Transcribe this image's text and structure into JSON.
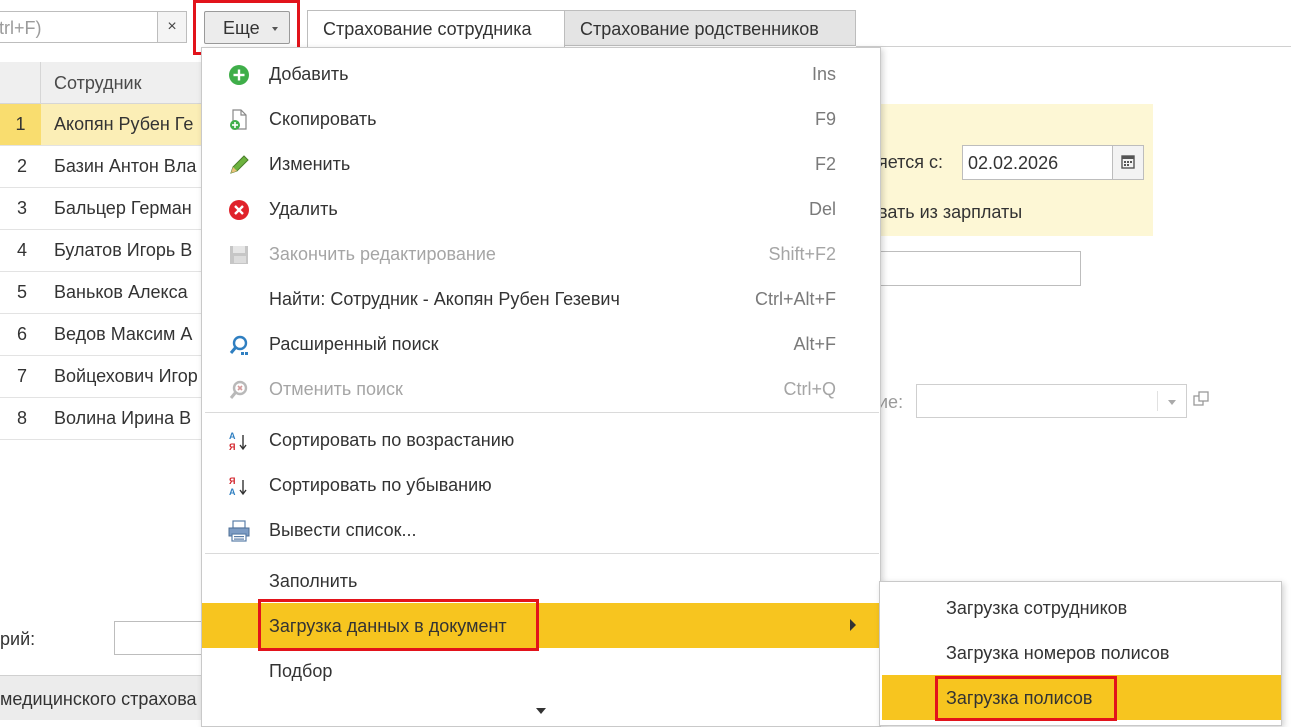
{
  "toolbar": {
    "search_placeholder": "(Ctrl+F)",
    "search_visible": "trl+F)",
    "clear_label": "×",
    "more_label": "Еще"
  },
  "tabs": [
    {
      "label": "Страхование сотрудника",
      "active": true
    },
    {
      "label": "Страхование родственников",
      "active": false
    }
  ],
  "table": {
    "header": "Сотрудник",
    "rows": [
      {
        "n": "1",
        "name": "Акопян Рубен Ге"
      },
      {
        "n": "2",
        "name": "Базин Антон Вла"
      },
      {
        "n": "3",
        "name": "Бальцер Герман"
      },
      {
        "n": "4",
        "name": "Булатов Игорь В"
      },
      {
        "n": "5",
        "name": "Ваньков Алекса"
      },
      {
        "n": "6",
        "name": "Ведов Максим А"
      },
      {
        "n": "7",
        "name": "Войцехович Игор"
      },
      {
        "n": "8",
        "name": "Волина Ирина В"
      }
    ]
  },
  "form": {
    "date_label": "яется с:",
    "date_value": "02.02.2026",
    "salary_text": "вать из зарплаты",
    "insurer_label": "ие:",
    "comment_label": "рий:",
    "bottom_text": "медицинского страхова"
  },
  "menu": {
    "items": [
      {
        "label": "Добавить",
        "shortcut": "Ins",
        "icon": "add-icon"
      },
      {
        "label": "Скопировать",
        "shortcut": "F9",
        "icon": "copy-icon"
      },
      {
        "label": "Изменить",
        "shortcut": "F2",
        "icon": "pencil-icon"
      },
      {
        "label": "Удалить",
        "shortcut": "Del",
        "icon": "delete-icon"
      },
      {
        "label": "Закончить редактирование",
        "shortcut": "Shift+F2",
        "icon": "save-icon",
        "disabled": true
      },
      {
        "label": "Найти: Сотрудник - Акопян Рубен Гезевич",
        "shortcut": "Ctrl+Alt+F"
      },
      {
        "label": "Расширенный поиск",
        "shortcut": "Alt+F",
        "icon": "search-icon"
      },
      {
        "label": "Отменить поиск",
        "shortcut": "Ctrl+Q",
        "icon": "cancel-search-icon",
        "disabled": true
      },
      {
        "label": "Сортировать по возрастанию",
        "icon": "sort-asc-icon"
      },
      {
        "label": "Сортировать по убыванию",
        "icon": "sort-desc-icon"
      },
      {
        "label": "Вывести список...",
        "icon": "print-icon"
      },
      {
        "label": "Заполнить"
      },
      {
        "label": "Загрузка данных в документ",
        "active": true
      },
      {
        "label": "Подбор"
      }
    ]
  },
  "submenu": {
    "items": [
      {
        "label": "Загрузка сотрудников"
      },
      {
        "label": "Загрузка номеров полисов"
      },
      {
        "label": "Загрузка полисов",
        "active": true
      }
    ]
  },
  "colors": {
    "highlight": "#f7c51f",
    "annotation_border": "#e2131b",
    "selected_row": "#fbeeb6",
    "form_panel": "#fdf7d5"
  }
}
